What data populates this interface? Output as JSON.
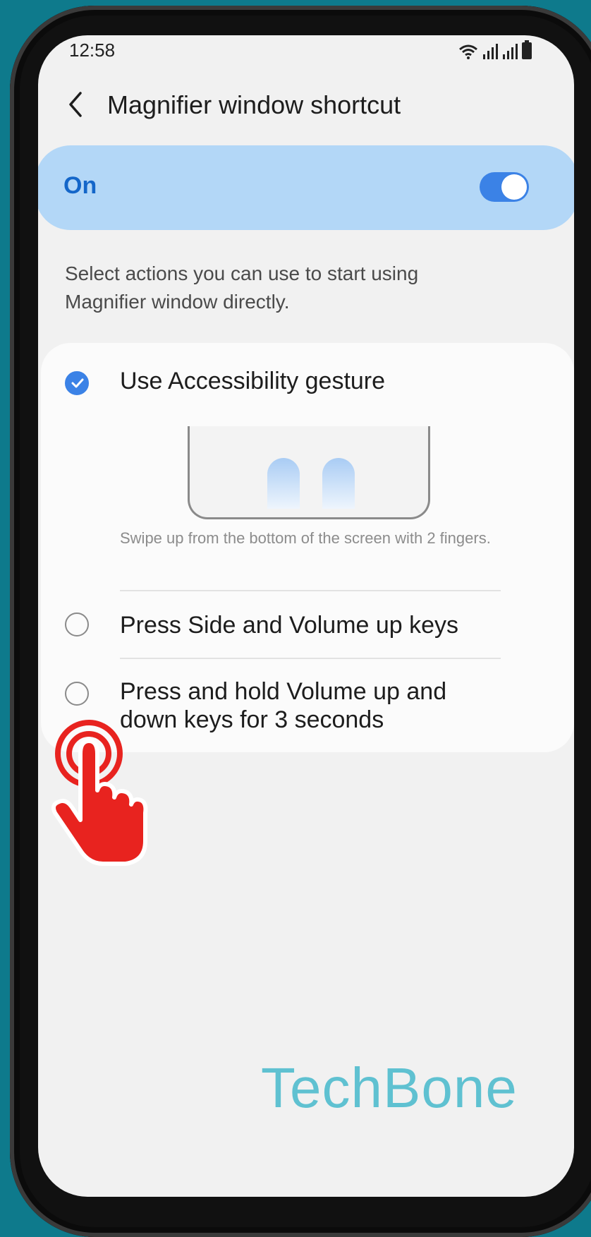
{
  "status_bar": {
    "time": "12:58"
  },
  "header": {
    "title": "Magnifier window shortcut"
  },
  "master_switch": {
    "label": "On",
    "state": true
  },
  "description": "Select actions you can use to start using Magnifier window directly.",
  "options": [
    {
      "label": "Use Accessibility gesture",
      "checked": true,
      "caption": "Swipe up from the bottom of the screen with 2 fingers."
    },
    {
      "label": "Press Side and Volume up keys",
      "checked": false
    },
    {
      "label": "Press and hold Volume up and down keys for 3 seconds",
      "checked": false
    }
  ],
  "watermark": "TechBone",
  "colors": {
    "accent": "#3b82e6",
    "switch_bg": "#b3d7f7",
    "tap_hand": "#e8231f"
  },
  "icons": [
    "wifi-icon",
    "signal-icon",
    "battery-icon",
    "back-icon",
    "check-icon",
    "tap-hand-icon"
  ]
}
